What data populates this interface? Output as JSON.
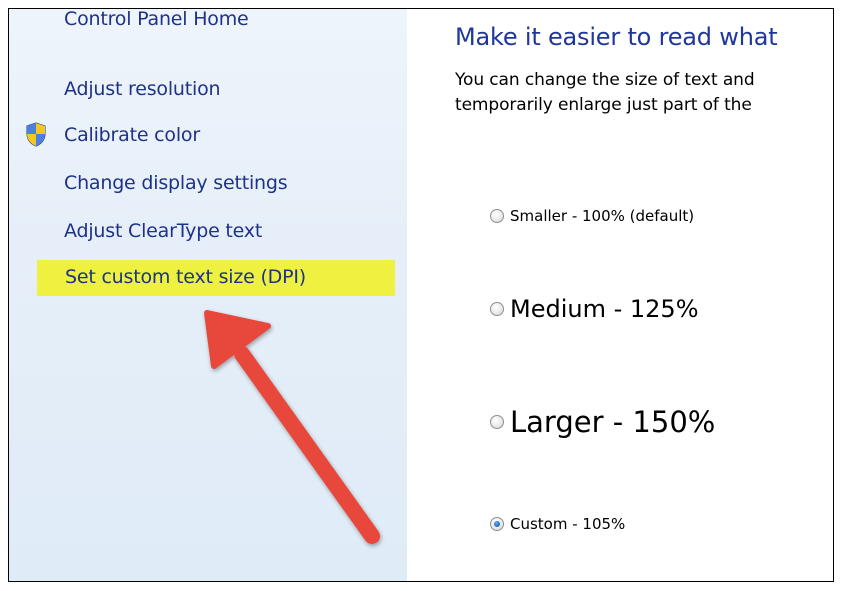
{
  "sidebar": {
    "items": [
      {
        "label": "Control Panel Home"
      },
      {
        "label": "Adjust resolution"
      },
      {
        "label": "Calibrate color",
        "icon": "uac-shield-icon"
      },
      {
        "label": "Change display settings"
      },
      {
        "label": "Adjust ClearType text"
      },
      {
        "label": "Set custom text size (DPI)",
        "highlighted": true
      }
    ]
  },
  "main": {
    "heading": "Make it easier to read what",
    "description_line1": "You can change the size of text and",
    "description_line2": "temporarily enlarge just part of the",
    "options": [
      {
        "label": "Smaller - 100% (default)",
        "selected": false
      },
      {
        "label": "Medium - 125%",
        "selected": false
      },
      {
        "label": "Larger - 150%",
        "selected": false
      },
      {
        "label": "Custom - 105%",
        "selected": true
      }
    ]
  },
  "colors": {
    "link": "#1e3287",
    "heading": "#1e3799",
    "highlight": "#eef13f",
    "arrow": "#e8473a",
    "sidebar_bg": "#e6eff9"
  }
}
